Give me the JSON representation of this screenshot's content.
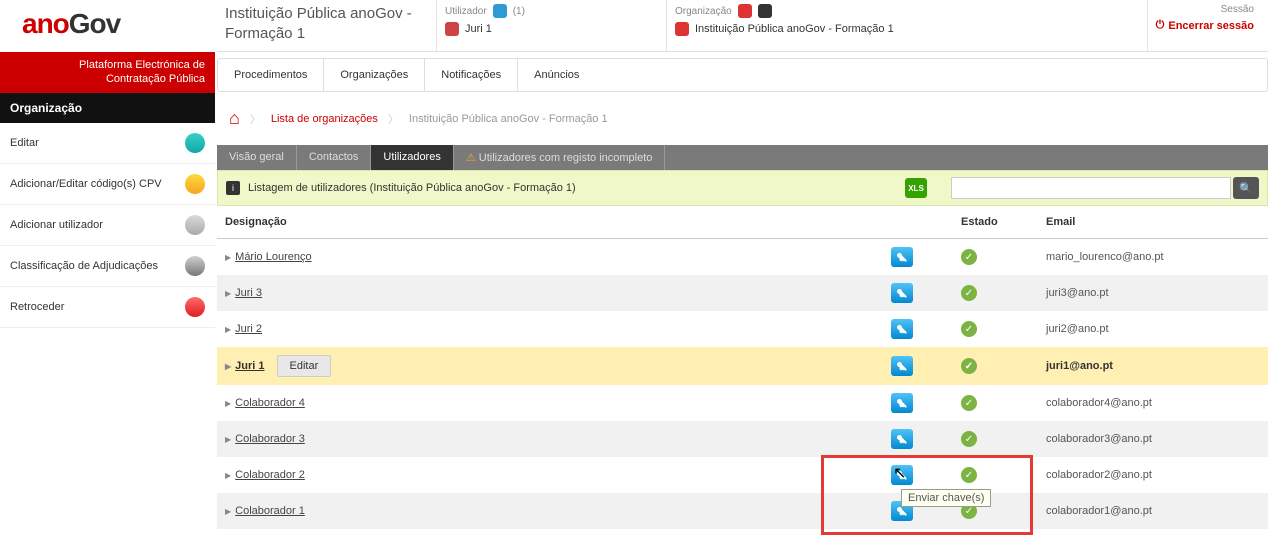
{
  "logo": {
    "part1": "ano",
    "part2": "Gov"
  },
  "brand_tagline_l1": "Plataforma Electrónica de",
  "brand_tagline_l2": "Contratação Pública",
  "header": {
    "inst_title": "Instituição Pública anoGov - Formação 1",
    "user_label": "Utilizador",
    "user_count": "(1)",
    "user_name": "Juri 1",
    "org_label": "Organização",
    "org_name": "Instituição Pública anoGov - Formação 1",
    "session_label": "Sessão",
    "session_action": "Encerrar sessão"
  },
  "left_nav": {
    "title": "Organização",
    "items": [
      {
        "label": "Editar",
        "icon": "ic-edit"
      },
      {
        "label": "Adicionar/Editar código(s) CPV",
        "icon": "ic-star"
      },
      {
        "label": "Adicionar utilizador",
        "icon": "ic-sparkle"
      },
      {
        "label": "Classificação de Adjudicações",
        "icon": "ic-class"
      },
      {
        "label": "Retroceder",
        "icon": "ic-back"
      }
    ]
  },
  "main_tabs": [
    "Procedimentos",
    "Organizações",
    "Notificações",
    "Anúncios"
  ],
  "breadcrumb": {
    "link": "Lista de organizações",
    "current": "Instituição Pública anoGov - Formação 1"
  },
  "sub_tabs": [
    {
      "label": "Visão geral",
      "active": false,
      "warn": false
    },
    {
      "label": "Contactos",
      "active": false,
      "warn": false
    },
    {
      "label": "Utilizadores",
      "active": true,
      "warn": false
    },
    {
      "label": "Utilizadores com registo incompleto",
      "active": false,
      "warn": true
    }
  ],
  "listing_title": "Listagem de utilizadores (Instituição Pública anoGov - Formação 1)",
  "search_placeholder": "",
  "columns": {
    "name": "Designação",
    "status": "Estado",
    "email": "Email"
  },
  "rows": [
    {
      "name": "Mário Lourenço",
      "email": "mario_lourenco@ano.pt",
      "selected": false
    },
    {
      "name": "Juri 3",
      "email": "juri3@ano.pt",
      "selected": false
    },
    {
      "name": "Juri 2",
      "email": "juri2@ano.pt",
      "selected": false
    },
    {
      "name": "Juri 1",
      "email": "juri1@ano.pt",
      "selected": true,
      "edit_label": "Editar"
    },
    {
      "name": "Colaborador 4",
      "email": "colaborador4@ano.pt",
      "selected": false
    },
    {
      "name": "Colaborador 3",
      "email": "colaborador3@ano.pt",
      "selected": false
    },
    {
      "name": "Colaborador 2",
      "email": "colaborador2@ano.pt",
      "selected": false
    },
    {
      "name": "Colaborador 1",
      "email": "colaborador1@ano.pt",
      "selected": false
    }
  ],
  "tooltip": "Enviar chave(s)",
  "xls_label": "XLS"
}
